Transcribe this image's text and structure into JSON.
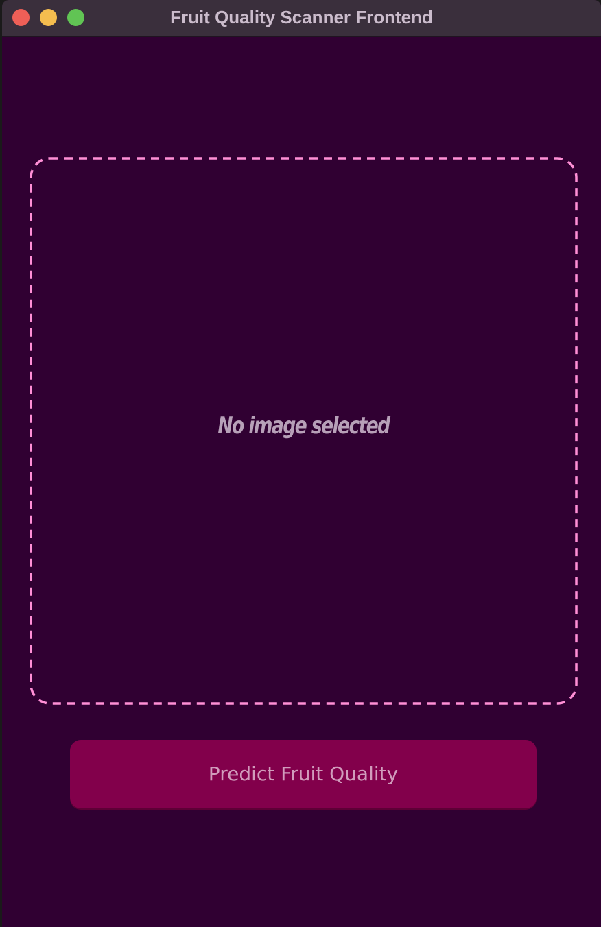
{
  "window": {
    "title": "Fruit Quality Scanner Frontend"
  },
  "dropzone": {
    "placeholder": "No image selected",
    "border_color": "#ff8fd6"
  },
  "actions": {
    "predict_label": "Predict Fruit Quality"
  },
  "colors": {
    "background": "#300032",
    "button": "#82004b",
    "button_text": "#d19cbc"
  }
}
